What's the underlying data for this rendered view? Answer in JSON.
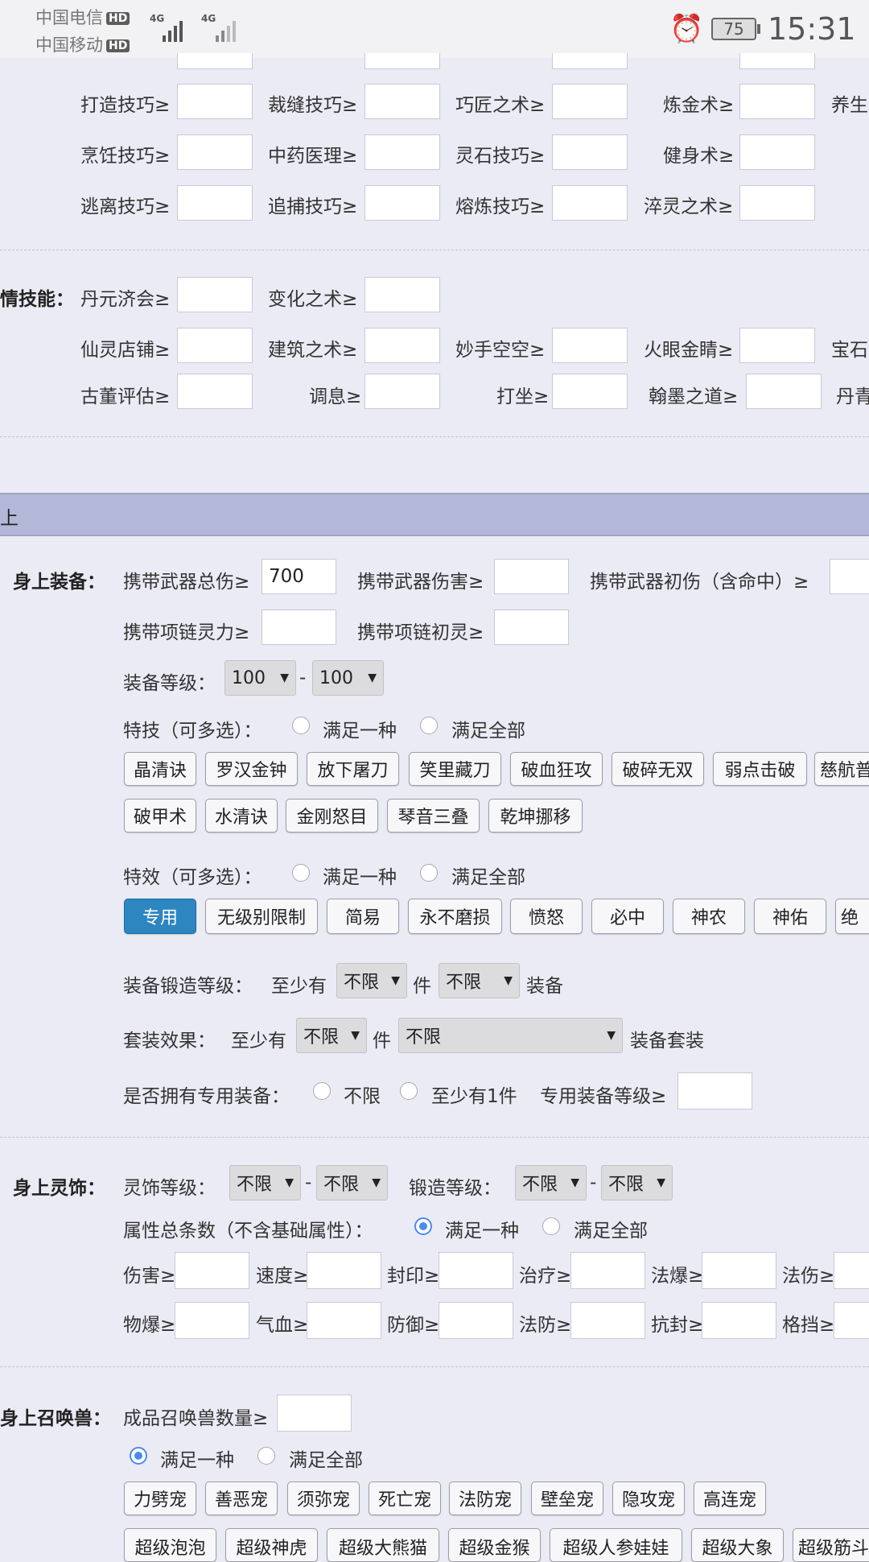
{
  "status_bar": {
    "carrier1": "中国电信",
    "carrier2": "中国移动",
    "hd": "HD",
    "net1": "4G",
    "net2": "4G",
    "battery": "75",
    "time": "15:31"
  },
  "skills": {
    "row1": [
      "打造技巧≥",
      "裁缝技巧≥",
      "巧匠之术≥",
      "炼金术≥",
      "养生"
    ],
    "row2": [
      "烹饪技巧≥",
      "中药医理≥",
      "灵石技巧≥",
      "健身术≥"
    ],
    "row3": [
      "逃离技巧≥",
      "追捕技巧≥",
      "熔炼技巧≥",
      "淬灵之术≥"
    ]
  },
  "special_skills": {
    "title": "情技能：",
    "row1": [
      "丹元济会≥",
      "变化之术≥"
    ],
    "row2": [
      "仙灵店铺≥",
      "建筑之术≥",
      "妙手空空≥",
      "火眼金睛≥",
      "宝石"
    ],
    "row3": [
      "古董评估≥",
      "调息≥",
      "打坐≥",
      "翰墨之道≥",
      "丹青"
    ]
  },
  "section_header": {
    "title": "上"
  },
  "equipment": {
    "title": "身上装备：",
    "weapon_total_damage_label": "携带武器总伤≥",
    "weapon_total_damage_value": "700",
    "weapon_damage_label": "携带武器伤害≥",
    "weapon_initial_label": "携带武器初伤（含命中）≥",
    "necklace_spirit_label": "携带项链灵力≥",
    "necklace_initial_spirit_label": "携带项链初灵≥",
    "level_label": "装备等级：",
    "level_min": "100",
    "level_max": "100",
    "range_sep": "-",
    "skill_label": "特技（可多选）：",
    "match_one": "满足一种",
    "match_all": "满足全部",
    "skill_tags_row1": [
      "晶清诀",
      "罗汉金钟",
      "放下屠刀",
      "笑里藏刀",
      "破血狂攻",
      "破碎无双",
      "弱点击破",
      "慈航普"
    ],
    "skill_tags_row2": [
      "破甲术",
      "水清诀",
      "金刚怒目",
      "琴音三叠",
      "乾坤挪移"
    ],
    "effect_label": "特效（可多选）：",
    "effect_tags": [
      "专用",
      "无级别限制",
      "简易",
      "永不磨损",
      "愤怒",
      "必中",
      "神农",
      "神佑",
      "绝"
    ],
    "forge_label": "装备锻造等级：",
    "at_least": "至少有",
    "unlimited": "不限",
    "piece": "件",
    "equipment_word": "装备",
    "set_label": "套装效果：",
    "set_suffix": "装备套装",
    "exclusive_label": "是否拥有专用装备：",
    "exclusive_none": "不限",
    "exclusive_one": "至少有1件",
    "exclusive_level_label": "专用装备等级≥"
  },
  "ornament": {
    "title": "身上灵饰：",
    "level_label": "灵饰等级：",
    "forge_label": "锻造等级：",
    "unlimited": "不限",
    "attr_label": "属性总条数（不含基础属性）：",
    "match_one": "满足一种",
    "match_all": "满足全部",
    "row1": [
      "伤害≥",
      "速度≥",
      "封印≥",
      "治疗≥",
      "法爆≥",
      "法伤≥"
    ],
    "row2": [
      "物爆≥",
      "气血≥",
      "防御≥",
      "法防≥",
      "抗封≥",
      "格挡≥"
    ]
  },
  "pets": {
    "title": "身上召唤兽：",
    "count_label": "成品召唤兽数量≥",
    "match_one": "满足一种",
    "match_all": "满足全部",
    "tags_row1": [
      "力劈宠",
      "善恶宠",
      "须弥宠",
      "死亡宠",
      "法防宠",
      "壁垒宠",
      "隐攻宠",
      "高连宠"
    ],
    "tags_row2": [
      "超级泡泡",
      "超级神虎",
      "超级大熊猫",
      "超级金猴",
      "超级人参娃娃",
      "超级大象",
      "超级筋斗"
    ]
  },
  "colors": {
    "accent": "#2e86c1",
    "radio_on": "#4a8cef",
    "header_bg": "#b3b8d8",
    "page_bg": "#ebebf5"
  }
}
